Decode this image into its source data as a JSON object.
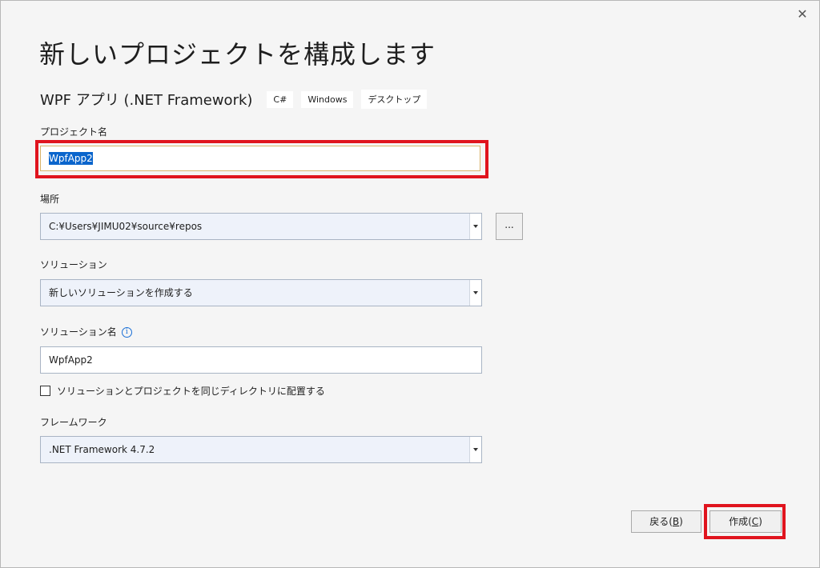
{
  "dialog": {
    "title": "新しいプロジェクトを構成します",
    "close_label": "✕"
  },
  "template": {
    "name": "WPF アプリ (.NET Framework)",
    "tags": [
      "C#",
      "Windows",
      "デスクトップ"
    ]
  },
  "project_name": {
    "label": "プロジェクト名",
    "value": "WpfApp2"
  },
  "location": {
    "label": "場所",
    "value": "C:¥Users¥JIMU02¥source¥repos",
    "browse_label": "..."
  },
  "solution": {
    "label": "ソリューション",
    "value": "新しいソリューションを作成する"
  },
  "solution_name": {
    "label": "ソリューション名",
    "value": "WpfApp2",
    "info_icon": "info-icon"
  },
  "same_directory": {
    "label": "ソリューションとプロジェクトを同じディレクトリに配置する",
    "checked": false
  },
  "framework": {
    "label": "フレームワーク",
    "value": ".NET Framework 4.7.2"
  },
  "buttons": {
    "back_prefix": "戻る(",
    "back_key": "B",
    "back_suffix": ")",
    "create_prefix": "作成(",
    "create_key": "C",
    "create_suffix": ")"
  },
  "highlight_color": "#e0141e"
}
